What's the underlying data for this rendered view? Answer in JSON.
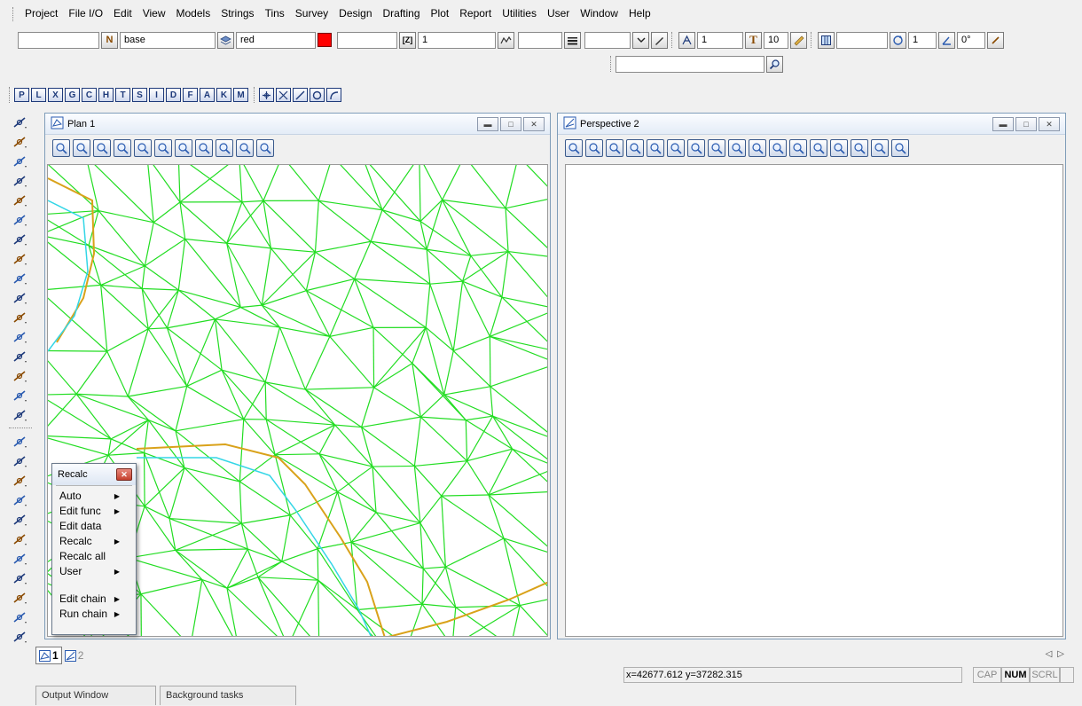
{
  "menu": [
    "Project",
    "File I/O",
    "Edit",
    "View",
    "Models",
    "Strings",
    "Tins",
    "Survey",
    "Design",
    "Drafting",
    "Plot",
    "Report",
    "Utilities",
    "User",
    "Window",
    "Help"
  ],
  "toolbar": {
    "model_field": "base",
    "model_btn": "N",
    "colour_field": "red",
    "colour_hex": "#ff0000",
    "weight_field": "1",
    "text_size_field": "1",
    "text_height_field": "10",
    "text_btn": "T",
    "angle_field_1": "1",
    "angle_field_2": "0°"
  },
  "mode_buttons": [
    "P",
    "L",
    "X",
    "G",
    "C",
    "H",
    "T",
    "S",
    "I",
    "D",
    "F",
    "A",
    "K",
    "M"
  ],
  "plan_window": {
    "title": "Plan 1"
  },
  "perspective_window": {
    "title": "Perspective 2"
  },
  "recalc_popup": {
    "title": "Recalc",
    "items": [
      {
        "label": "Auto",
        "submenu": true
      },
      {
        "label": "Edit func",
        "submenu": true
      },
      {
        "label": "Edit data",
        "submenu": false
      },
      {
        "label": "Recalc",
        "submenu": true
      },
      {
        "label": "Recalc all",
        "submenu": false
      },
      {
        "label": "User",
        "submenu": true
      },
      {
        "label": "Edit chain",
        "submenu": true
      },
      {
        "label": "Run chain",
        "submenu": true
      }
    ]
  },
  "view_tabs": [
    "1",
    "2"
  ],
  "status": {
    "coords": "x=42677.612 y=37282.315",
    "cap": "CAP",
    "num": "NUM",
    "scrl": "SCRL"
  },
  "output_tabs": [
    "Output Window",
    "Background tasks"
  ],
  "colors": {
    "tin_triangles": "#22dd22",
    "string_orange": "#d9a21a",
    "string_cyan": "#33d6e6"
  }
}
